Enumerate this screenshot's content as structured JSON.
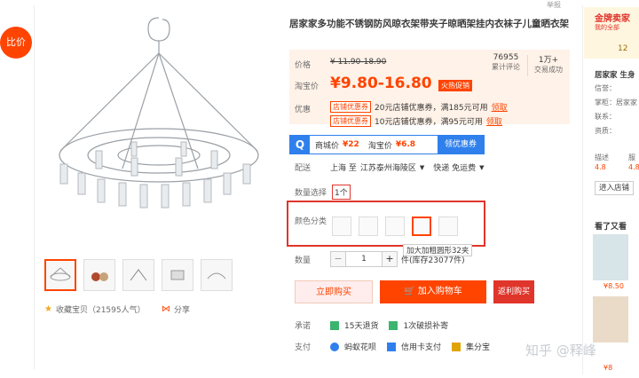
{
  "side_tag": "比价",
  "report": "举报",
  "product": {
    "title": "居家家多功能不锈钢防风晾衣架带夹子晾晒架挂内衣袜子儿童晒衣架",
    "price_label": "价格",
    "original_price": "¥ 11.90-18.90",
    "taobao_label": "淘宝价",
    "price": "¥9.80-16.80",
    "hot_badge": "火热促销",
    "reviews_count": "76955",
    "reviews_label": "累计评论",
    "sales_count": "1万+",
    "sales_label": "交易成功",
    "promo_label": "优惠",
    "coupons": [
      {
        "tag": "店铺优惠券",
        "text": "20元店铺优惠券，满185元可用",
        "claim": "领取"
      },
      {
        "tag": "店铺优惠券",
        "text": "10元店铺优惠券，满95元可用",
        "claim": "领取"
      }
    ]
  },
  "compare": {
    "icon": "Q",
    "mall_label": "商城价",
    "mall_price": "¥22",
    "taobao_label": "淘宝价",
    "taobao_price": "¥6.8",
    "coupon_btn": "领优惠券"
  },
  "delivery": {
    "label": "配送",
    "from": "上海 至",
    "to": "江苏泰州海陵区",
    "express": "快递 免运费"
  },
  "quantity_select": {
    "label": "数量选择",
    "value": "1个"
  },
  "color": {
    "label": "颜色分类",
    "tooltip": "加大加粗圆形32夹"
  },
  "qty": {
    "label": "数量",
    "value": "1",
    "stock": "件(库存23077件)"
  },
  "buttons": {
    "buy": "立即购买",
    "cart": "加入购物车",
    "back": "返利购买"
  },
  "promise": {
    "label": "承诺",
    "items": [
      "15天退货",
      "1次破损补寄"
    ]
  },
  "payment": {
    "label": "支付",
    "items": [
      "蚂蚁花呗",
      "信用卡支付",
      "集分宝"
    ]
  },
  "gallery": {
    "fav": "收藏宝贝（21595人气）",
    "share": "分享"
  },
  "shop": {
    "badge": "金牌卖家",
    "badge_sub": "我的全部",
    "number": "12",
    "name": "居家家 生身",
    "rows": [
      "信誉：",
      "掌柜：居家家",
      "联系：",
      "资质："
    ],
    "score_labels": [
      "描述",
      "服"
    ],
    "scores": [
      "4.8",
      "4.8"
    ],
    "enter": "进入店铺",
    "also_seen": "看了又看",
    "prices": [
      "¥8.50",
      "¥8"
    ]
  },
  "watermark": "知乎 @释峰",
  "colors": {
    "accent": "#ff4400",
    "blue": "#2f80ed",
    "red_box": "#e0352b"
  }
}
